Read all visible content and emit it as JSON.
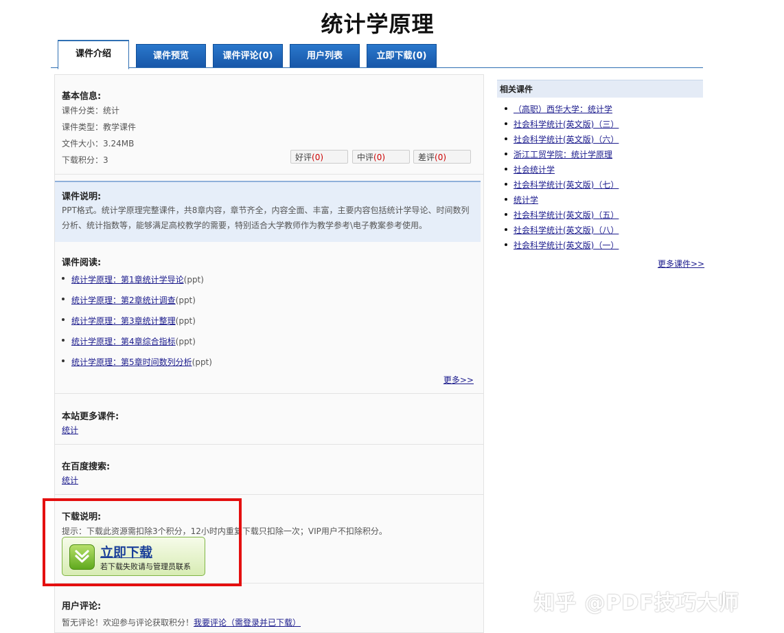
{
  "page_title": "统计学原理",
  "tabs": [
    {
      "label": "课件介绍",
      "active": true
    },
    {
      "label": "课件预览"
    },
    {
      "label": "课件评论(0)"
    },
    {
      "label": "用户列表"
    },
    {
      "label": "立即下载(0)"
    }
  ],
  "basic": {
    "title": "基本信息:",
    "category": "课件分类：统计",
    "type": "课件类型：教学课件",
    "size": "文件大小：3.24MB",
    "points": "下载积分：3",
    "ratings": [
      {
        "label": "好评",
        "count": "(0)"
      },
      {
        "label": "中评",
        "count": "(0)"
      },
      {
        "label": "差评",
        "count": "(0)"
      }
    ]
  },
  "description": {
    "title": "课件说明:",
    "text": "PPT格式。统计学原理完整课件，共8章内容，章节齐全，内容全面、丰富，主要内容包括统计学导论、时间数列分析、统计指数等，能够满足高校教学的需要，特别适合大学教师作为教学参考\\电子教案参考使用。"
  },
  "reading": {
    "title": "课件阅读:",
    "items": [
      {
        "link": "统计学原理：第1章统计学导论",
        "ext": "(ppt)"
      },
      {
        "link": "统计学原理：第2章统计调查",
        "ext": "(ppt)"
      },
      {
        "link": "统计学原理：第3章统计整理",
        "ext": "(ppt)"
      },
      {
        "link": "统计学原理：第4章综合指标",
        "ext": "(ppt)"
      },
      {
        "link": "统计学原理：第5章时间数列分析",
        "ext": "(ppt)"
      }
    ],
    "more": "更多>>"
  },
  "site_more": {
    "title": "本站更多课件:",
    "link": "统计"
  },
  "baidu": {
    "title": "在百度搜索:",
    "link": "统计"
  },
  "download": {
    "title": "下载说明:",
    "hint": "提示：下载此资源需扣除3个积分，12小时内重复下载只扣除一次；VIP用户不扣除积分。",
    "button_main": "立即下载",
    "button_sub": "若下载失败请与管理员联系"
  },
  "comments": {
    "title": "用户评论:",
    "text": "暂无评论！欢迎参与评论获取积分！",
    "link": "我要评论（需登录并已下载）"
  },
  "related": {
    "title": "相关课件",
    "items": [
      "（高职）西华大学：统计学",
      "社会科学统计(英文版)（三）",
      "社会科学统计(英文版)（六）",
      "浙江工贸学院：统计学原理",
      "社会统计学",
      "社会科学统计(英文版)（七）",
      "统计学",
      "社会科学统计(英文版)（五）",
      "社会科学统计(英文版)（八）",
      "社会科学统计(英文版)（一）"
    ],
    "more": "更多课件>>"
  },
  "watermark": "知乎 @PDF技巧大师",
  "colors": {
    "tab_blue": "#1c63b8",
    "highlight_red": "#e40f0f",
    "download_green": "#7fb544"
  }
}
